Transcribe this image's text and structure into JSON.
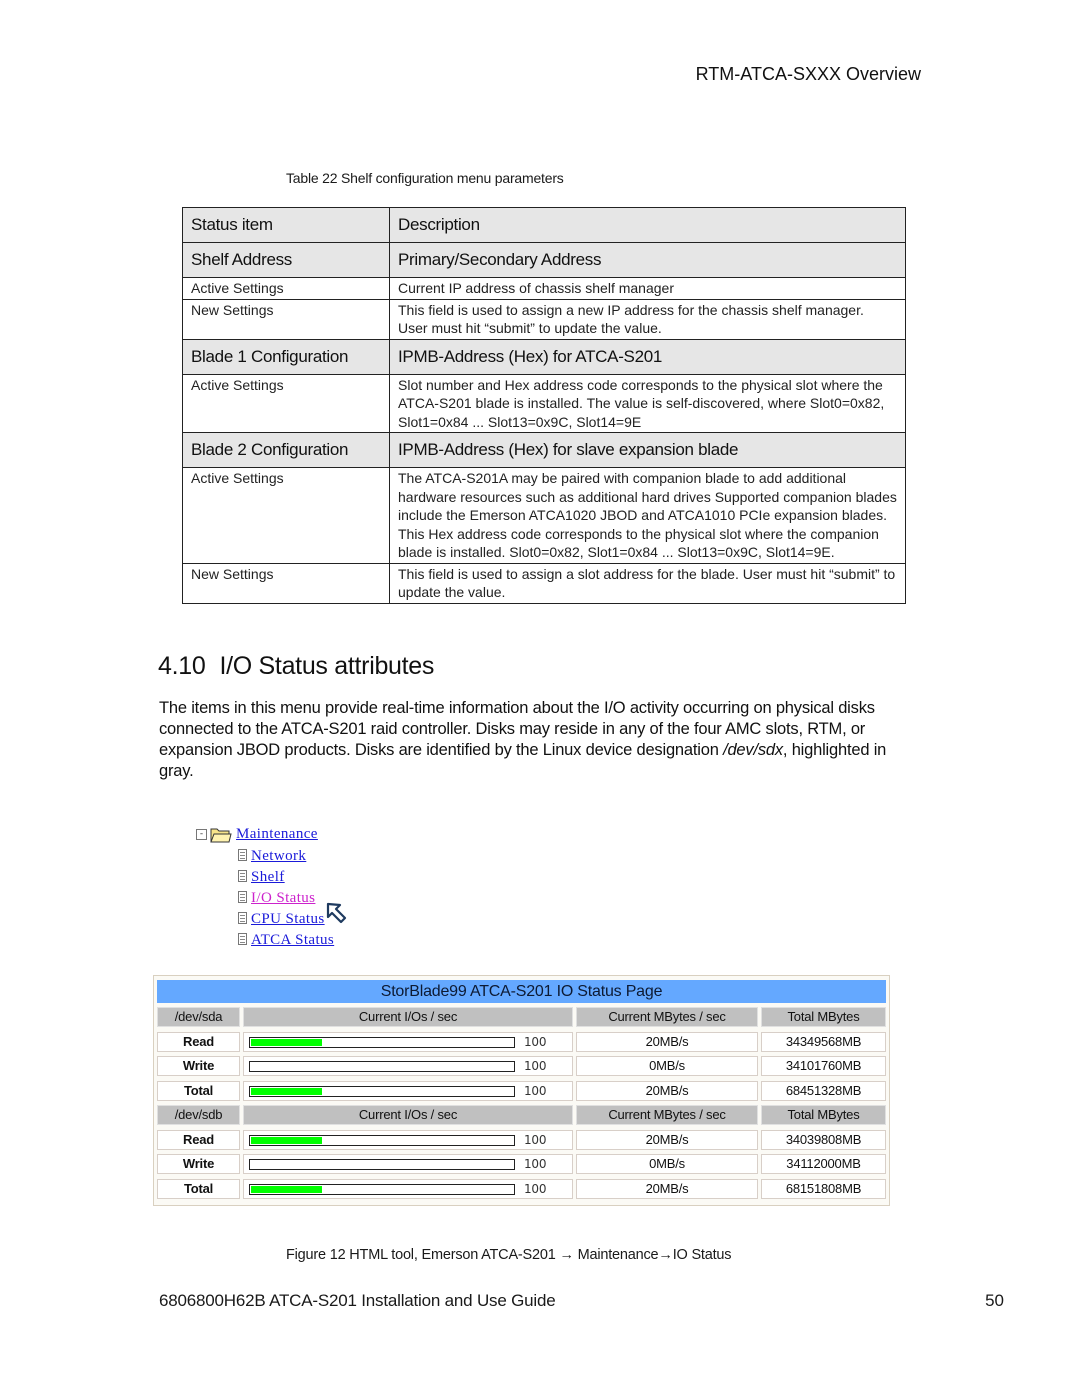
{
  "header": {
    "title": "RTM-ATCA-SXXX Overview"
  },
  "table_caption": "Table 22 Shelf configuration menu parameters",
  "spec_table": {
    "columns": [
      "Status item",
      "Description"
    ],
    "sections": [
      {
        "title": "Shelf Address",
        "subtitle": "Primary/Secondary Address",
        "rows": [
          {
            "item": "Active Settings",
            "description": "Current IP address of chassis shelf manager"
          },
          {
            "item": "New Settings",
            "description": "This field is used to assign a new IP address for the chassis shelf manager. User must hit “submit” to update the value."
          }
        ]
      },
      {
        "title": "Blade 1 Configuration",
        "subtitle": "IPMB-Address (Hex) for ATCA-S201",
        "rows": [
          {
            "item": "Active Settings",
            "description": "Slot number and Hex address code corresponds to the physical slot where the ATCA-S201 blade is installed.  The value is self-discovered, where  Slot0=0x82, Slot1=0x84 ... Slot13=0x9C, Slot14=9E"
          }
        ]
      },
      {
        "title": "Blade 2 Configuration",
        "subtitle": "IPMB-Address (Hex) for slave expansion blade",
        "rows": [
          {
            "item": "Active Settings",
            "description": "The ATCA-S201A may be paired with companion blade to add additional hardware resources such as additional hard drives  Supported companion blades include the Emerson ATCA1020 JBOD and ATCA1010 PCIe expansion blades.  This Hex address code corresponds to the physical slot where the companion blade is installed.  Slot0=0x82, Slot1=0x84 ... Slot13=0x9C, Slot14=9E."
          },
          {
            "item": "New Settings",
            "description": "This field is used to assign a slot address for the blade.  User must hit “submit” to update the value."
          }
        ]
      }
    ]
  },
  "section": {
    "number": "4.10",
    "title": "I/O Status attributes",
    "paragraph_before": "The items in this menu provide real-time information about the I/O activity occurring on physical disks connected to the ATCA-S201 raid controller.  Disks may reside in any of the four AMC slots, RTM, or expansion JBOD products.  Disks are identified by the Linux device designation ",
    "paragraph_italic": "/dev/sdx",
    "paragraph_after": ", highlighted in gray."
  },
  "tree": {
    "root": "Maintenance",
    "items": [
      {
        "label": "Network",
        "active": false
      },
      {
        "label": "Shelf",
        "active": false
      },
      {
        "label": "I/O Status",
        "active": true
      },
      {
        "label": "CPU Status",
        "active": false
      },
      {
        "label": "ATCA Status",
        "active": false
      }
    ]
  },
  "io_panel": {
    "title": "StorBlade99 ATCA-S201 IO Status Page",
    "colors": {
      "title_bg": "#64a8ff",
      "header_bg": "#c0c0c0",
      "bar_fill": "#00ff00"
    },
    "devices": [
      {
        "name": "/dev/sda",
        "headers": [
          "Current I/Os / sec",
          "Current MBytes / sec",
          "Total MBytes"
        ],
        "rows": [
          {
            "label": "Read",
            "io_fraction": 0.27,
            "io_max": "100",
            "mbps": "20MB/s",
            "total": "34349568MB"
          },
          {
            "label": "Write",
            "io_fraction": 0.0,
            "io_max": "100",
            "mbps": "0MB/s",
            "total": "34101760MB"
          },
          {
            "label": "Total",
            "io_fraction": 0.27,
            "io_max": "100",
            "mbps": "20MB/s",
            "total": "68451328MB"
          }
        ]
      },
      {
        "name": "/dev/sdb",
        "headers": [
          "Current I/Os / sec",
          "Current MBytes / sec",
          "Total MBytes"
        ],
        "rows": [
          {
            "label": "Read",
            "io_fraction": 0.27,
            "io_max": "100",
            "mbps": "20MB/s",
            "total": "34039808MB"
          },
          {
            "label": "Write",
            "io_fraction": 0.0,
            "io_max": "100",
            "mbps": "0MB/s",
            "total": "34112000MB"
          },
          {
            "label": "Total",
            "io_fraction": 0.27,
            "io_max": "100",
            "mbps": "20MB/s",
            "total": "68151808MB"
          }
        ]
      }
    ]
  },
  "figure_caption": "Figure 12 HTML tool, Emerson ATCA-S201 → Maintenance→IO Status",
  "footer": {
    "doc": "6806800H62B ATCA-S201 Installation and Use Guide",
    "page": "50"
  }
}
